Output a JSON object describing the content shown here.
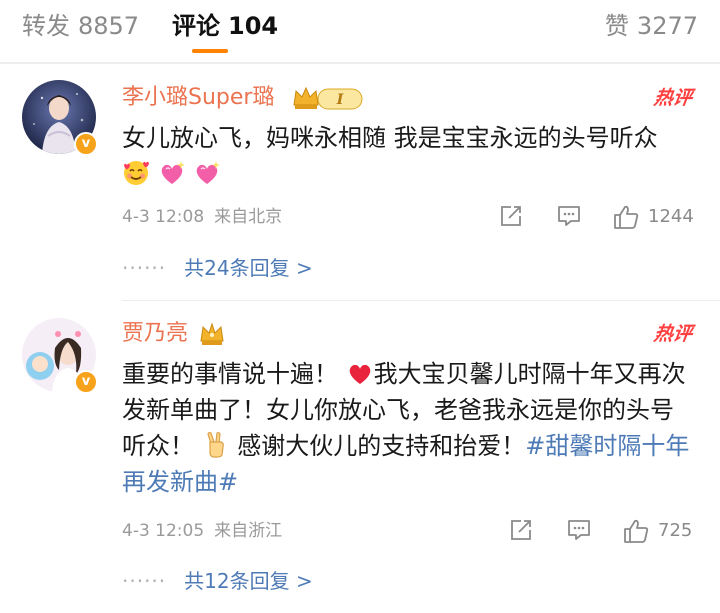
{
  "tabs": {
    "repost": {
      "label": "转发",
      "count": "8857"
    },
    "comments": {
      "label": "评论",
      "count": "104"
    },
    "likes": {
      "label": "赞",
      "count": "3277"
    }
  },
  "comments": [
    {
      "username": "李小璐Super璐",
      "badge": "hot",
      "hot_label": "热评",
      "text": "女儿放心飞，妈咪永相随 我是宝宝永远的头号听众",
      "emojis": [
        "smiling-face-with-hearts",
        "sparkling-heart",
        "sparkling-heart"
      ],
      "date": "4-3 12:08",
      "location": "来自北京",
      "like_count": "1244",
      "replies_dots": "······",
      "replies_label": "共24条回复 >"
    },
    {
      "username": "贾乃亮",
      "badge": "hot",
      "hot_label": "热评",
      "text_a": "重要的事情说十遍！",
      "text_b": "我大宝贝馨儿时隔十年又再次发新单曲了！女儿你放心飞，老爸我永远是你的头号听众！",
      "text_c": "感谢大伙儿的支持和抬爱！",
      "hashtag": "#甜馨时隔十年再发新曲#",
      "emojis": [
        "red-heart",
        "victory-hand"
      ],
      "date": "4-3 12:05",
      "location": "来自浙江",
      "like_count": "725",
      "replies_dots": "······",
      "replies_label": "共12条回复 >"
    }
  ],
  "verified_badge": "v",
  "colors": {
    "accent_orange": "#ff8200",
    "username": "#eb7350",
    "link_blue": "#4e7bb6",
    "hot_red": "#ff4040",
    "meta_gray": "#9a9a9a"
  }
}
